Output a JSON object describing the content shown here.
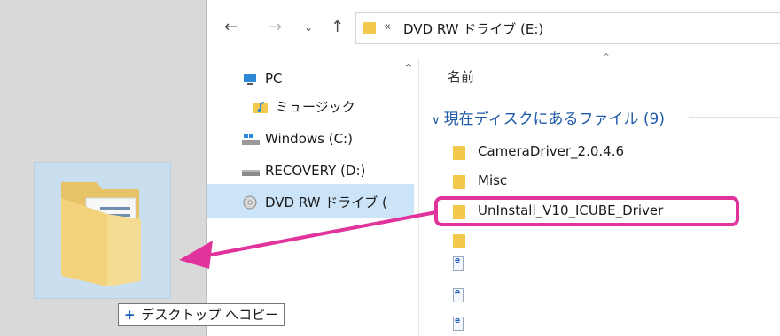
{
  "address": {
    "prefix": "«",
    "path": "DVD RW ドライブ (E:)"
  },
  "nav_pane": {
    "items": [
      {
        "label": "PC",
        "icon": "pc-icon"
      },
      {
        "label": "ミュージック",
        "icon": "music-folder-icon"
      },
      {
        "label": "Windows (C:)",
        "icon": "windows-drive-icon"
      },
      {
        "label": "RECOVERY (D:)",
        "icon": "drive-icon"
      },
      {
        "label": "DVD RW ドライブ (",
        "icon": "dvd-icon",
        "selected": true
      }
    ]
  },
  "content": {
    "column_header": "名前",
    "group_header": "現在ディスクにあるファイル (9)",
    "files": [
      {
        "name": "CameraDriver_2.0.4.6",
        "type": "folder"
      },
      {
        "name": "Misc",
        "type": "folder"
      },
      {
        "name": "UnInstall_V10_ICUBE_Driver",
        "type": "folder",
        "highlighted": true
      },
      {
        "name": "",
        "type": "folder"
      },
      {
        "name": "",
        "type": "document"
      },
      {
        "name": "",
        "type": "document"
      },
      {
        "name": "",
        "type": "document"
      }
    ]
  },
  "drag": {
    "tooltip_text": "デスクトップ へコピー",
    "tooltip_prefix": "+"
  },
  "colors": {
    "highlight": "#e0339b",
    "selection": "#cce4f7",
    "group_header": "#1e5aa8",
    "folder": "#f2c94c"
  }
}
